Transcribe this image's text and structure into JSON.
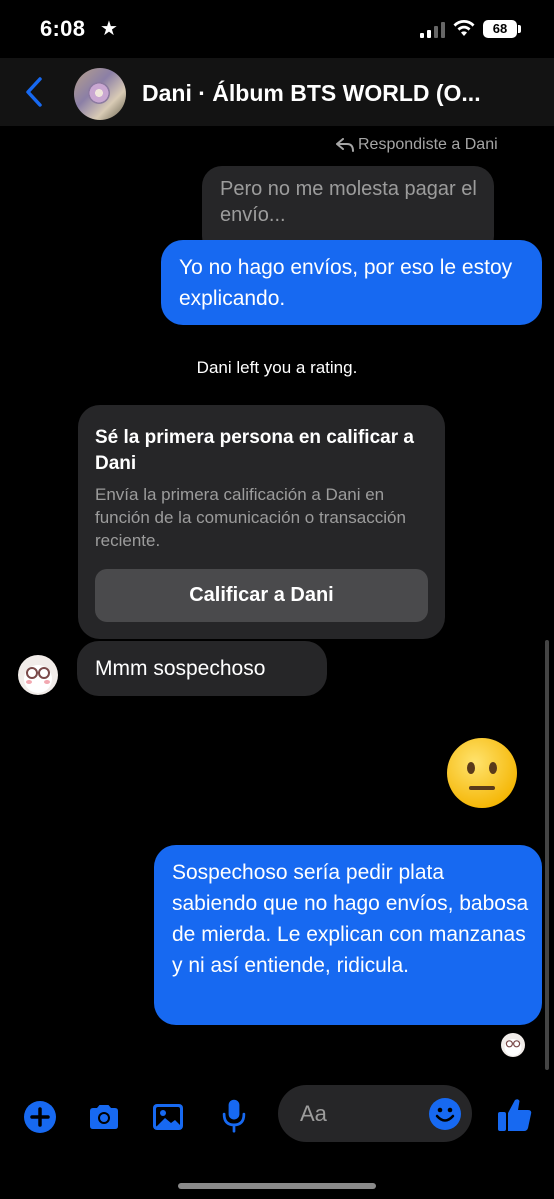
{
  "status_bar": {
    "time": "6:08",
    "battery": "68"
  },
  "header": {
    "title": "Dani · Álbum BTS WORLD (O..."
  },
  "reply": {
    "label": "Respondiste a Dani"
  },
  "messages": {
    "quoted": "Pero no me molesta pagar el envío...",
    "out_1": "Yo no hago envíos, por eso le estoy explicando.",
    "rating_note": "Dani left you a rating.",
    "rating_card": {
      "title": "Sé la primera persona en calificar a Dani",
      "description": "Envía la primera calificación a Dani en función de la comunicación o transacción reciente.",
      "button": "Calificar a Dani"
    },
    "in_1": "Mmm sospechoso",
    "emoji": "😐",
    "out_2": "Sospechoso sería pedir plata sabiendo que no hago envíos, babosa de mierda. Le explican con manzanas y ni así entiende, ridicula."
  },
  "composer": {
    "placeholder": "Aa"
  },
  "colors": {
    "accent": "#1769f1",
    "bubble_gray": "#262628",
    "background": "#000000"
  }
}
